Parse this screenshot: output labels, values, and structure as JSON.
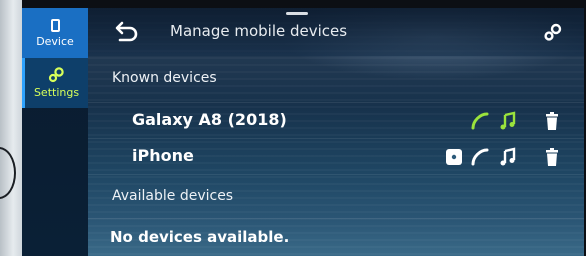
{
  "rail": {
    "device_label": "Device",
    "settings_label": "Settings"
  },
  "header": {
    "title": "Manage mobile devices"
  },
  "known": {
    "label": "Known devices",
    "devices": [
      {
        "name": "Galaxy A8 (2018)",
        "icons": [
          "phone-icon",
          "music-icon",
          "trash-icon"
        ],
        "icon_color": "#9be33c"
      },
      {
        "name": "iPhone",
        "icons": [
          "projection-icon",
          "phone-icon",
          "music-icon",
          "trash-icon"
        ],
        "icon_color": "#ffffff"
      }
    ]
  },
  "available": {
    "label": "Available devices",
    "empty_message": "No devices available."
  },
  "colors": {
    "active_tab": "#1a6fc3",
    "settings_accent": "#d7ff5a",
    "connected_green": "#9be33c"
  }
}
